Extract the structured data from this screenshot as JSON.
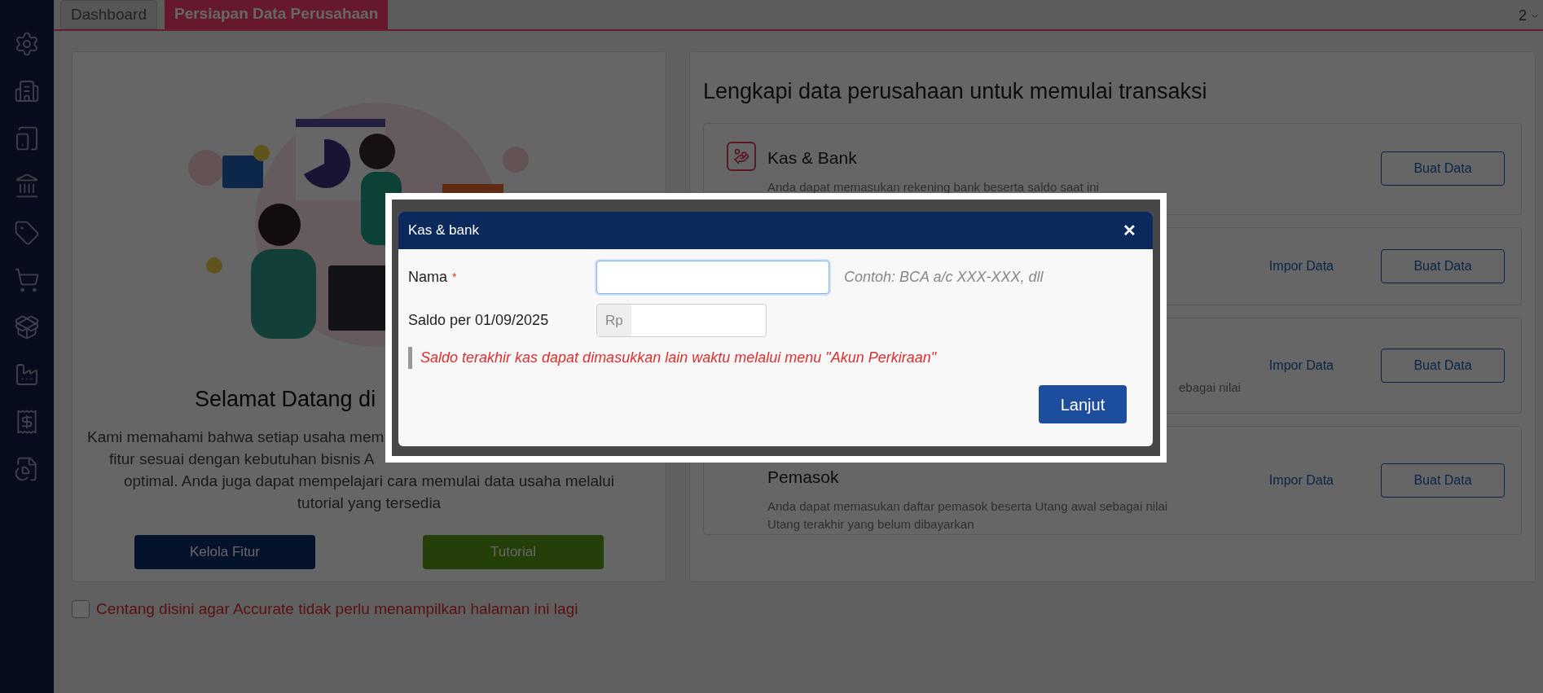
{
  "tabs": [
    {
      "label": "Dashboard",
      "selected": false
    },
    {
      "label": "Persiapan Data Perusahaan",
      "selected": true
    }
  ],
  "tab_counter": "2",
  "welcome": {
    "heading": "Selamat Datang di",
    "paragraph_lines": [
      {
        "text": "Kami memahami bahwa setiap usaha mem",
        "kind": "cut"
      },
      {
        "text": "fitur sesuai dengan kebutuhan bisnis A",
        "kind": "cut_indent"
      },
      {
        "text": "optimal. Anda juga dapat mempelajari cara memulai data usaha melalui",
        "kind": "center"
      },
      {
        "text": "tutorial yang tersedia",
        "kind": "center"
      }
    ],
    "buttons": [
      {
        "label": "Kelola Fitur",
        "kind": "primary"
      },
      {
        "label": "Tutorial",
        "kind": "success"
      }
    ]
  },
  "dont_show_again": {
    "label": "Centang disini agar Accurate tidak perlu menampilkan halaman ini lagi",
    "checked": false
  },
  "setup": {
    "title": "Lengkapi data perusahaan untuk memulai transaksi",
    "cards": [
      {
        "title": "Kas & Bank",
        "description": [
          "Anda dapat memasukan rekening bank beserta saldo saat ini"
        ],
        "actions": [
          {
            "label": "Buat Data",
            "kind": "outline"
          }
        ]
      },
      {
        "actions": [
          {
            "label": "Impor Data",
            "kind": "link"
          },
          {
            "label": "Buat Data",
            "kind": "outline"
          }
        ]
      },
      {
        "description_tail": "ebagai nilai",
        "actions": [
          {
            "label": "Impor Data",
            "kind": "link"
          },
          {
            "label": "Buat Data",
            "kind": "outline"
          }
        ]
      },
      {
        "title": "Pemasok",
        "description": [
          "Anda dapat memasukan daftar pemasok beserta Utang awal sebagai nilai",
          "Utang terakhir yang belum dibayarkan"
        ],
        "actions": [
          {
            "label": "Impor Data",
            "kind": "link"
          },
          {
            "label": "Buat Data",
            "kind": "outline"
          }
        ]
      }
    ]
  },
  "dialog": {
    "title": "Kas & bank",
    "close": "✕",
    "fields": [
      {
        "label": "Nama",
        "required_mark": "*",
        "kind": "text",
        "focused": true,
        "hint": "Contoh: BCA a/c XXX-XXX, dll"
      },
      {
        "label": "Saldo per 01/09/2025",
        "kind": "currency",
        "focused": false,
        "prefix": "Rp"
      }
    ],
    "note": "Saldo terakhir kas dapat dimasukkan lain waktu melalui menu \"Akun Perkiraan\"",
    "submit": "Lanjut"
  }
}
